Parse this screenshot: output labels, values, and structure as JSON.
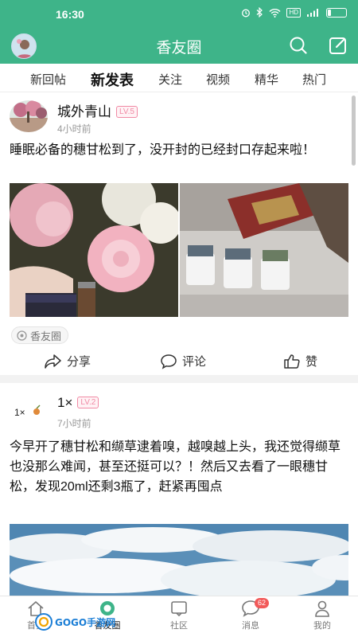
{
  "status_bar": {
    "time": "16:30",
    "battery": "19",
    "hd": "HD"
  },
  "header": {
    "title": "香友圈"
  },
  "tabs": [
    {
      "label": "新回帖"
    },
    {
      "label": "新发表"
    },
    {
      "label": "关注"
    },
    {
      "label": "视频"
    },
    {
      "label": "精华"
    },
    {
      "label": "热门"
    }
  ],
  "active_tab": "新发表",
  "posts": [
    {
      "author": "城外青山",
      "level": "LV.5",
      "time": "4小时前",
      "text": "睡眠必备的穗甘松到了，没开封的已经封口存起来啦！",
      "tag": "香友圈",
      "actions": {
        "share": "分享",
        "comment": "评论",
        "like": "赞"
      }
    },
    {
      "author": "1×",
      "avatar_text": "1×",
      "level": "LV.2",
      "time": "7小时前",
      "text": "今早开了穗甘松和缬草逮着嗅，越嗅越上头，我还觉得缬草也没那么难闻，甚至还挺可以？！然后又去看了一眼穗甘松，发现20ml还剩3瓶了，赶紧再囤点"
    }
  ],
  "bottom_nav": [
    {
      "label": "首页"
    },
    {
      "label": "香友圈"
    },
    {
      "label": "社区"
    },
    {
      "label": "消息",
      "badge": "62"
    },
    {
      "label": "我的"
    }
  ],
  "watermark": {
    "text": "GOGO手游网"
  },
  "colors": {
    "brand": "#3eb489",
    "badge": "#f25a5a",
    "level": "#f08aa5"
  }
}
